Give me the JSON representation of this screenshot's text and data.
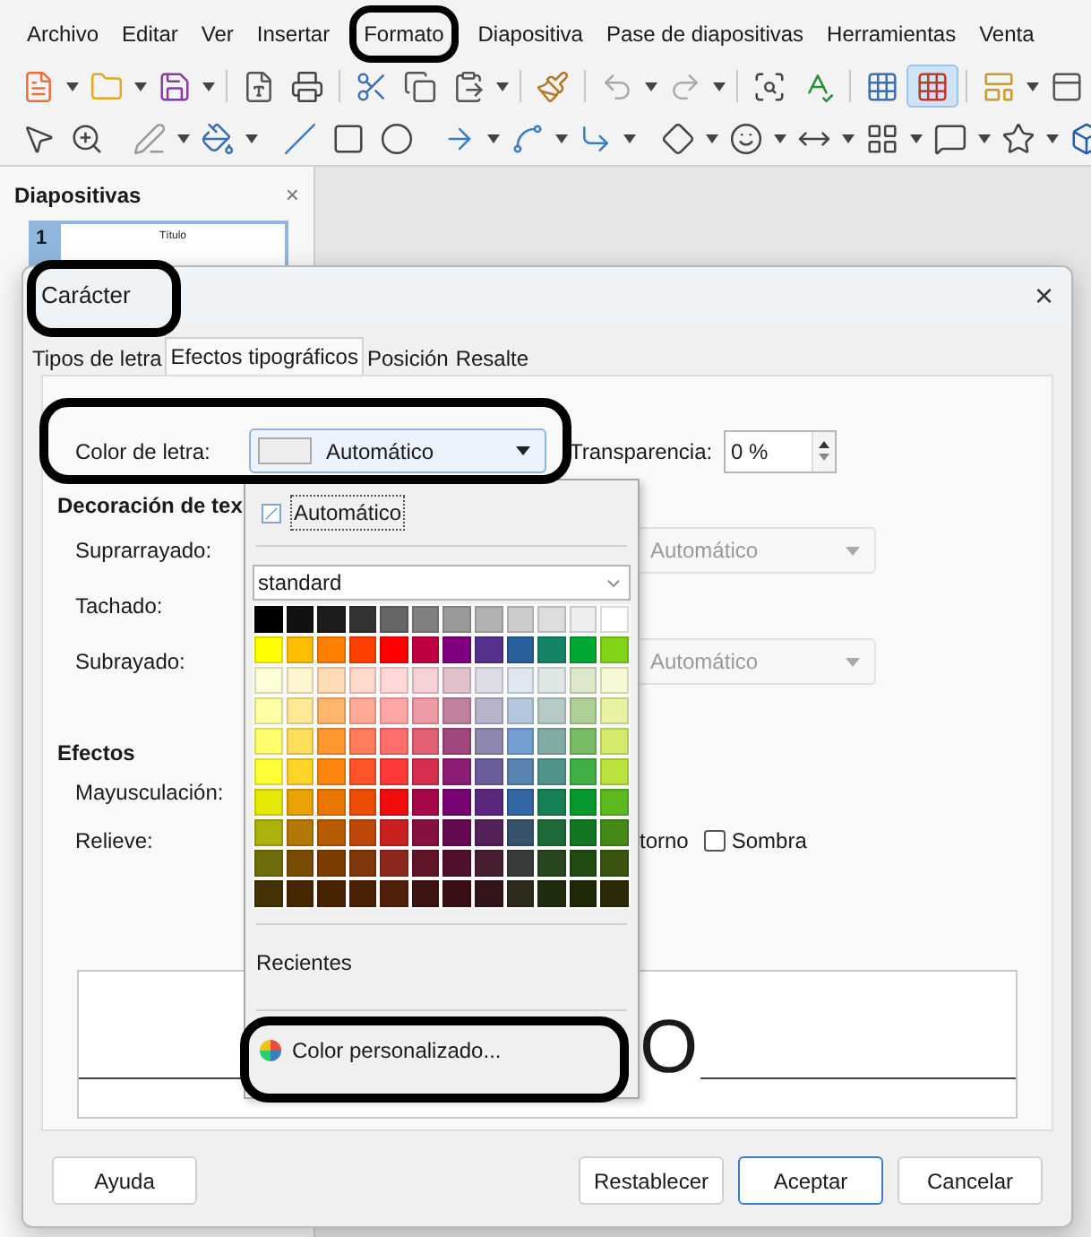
{
  "menu_bar": [
    {
      "label": "Archivo",
      "annotated": false
    },
    {
      "label": "Editar",
      "annotated": false
    },
    {
      "label": "Ver",
      "annotated": false
    },
    {
      "label": "Insertar",
      "annotated": false
    },
    {
      "label": "Formato",
      "annotated": true
    },
    {
      "label": "Diapositiva",
      "annotated": false
    },
    {
      "label": "Pase de diapositivas",
      "annotated": false
    },
    {
      "label": "Herramientas",
      "annotated": false
    },
    {
      "label": "Venta",
      "annotated": false
    }
  ],
  "toolbar": {
    "snap_grid_selected": true
  },
  "sidebar": {
    "title": "Diapositivas",
    "close": "×",
    "slides": [
      {
        "number": "1",
        "title": "Título",
        "selected": true
      }
    ]
  },
  "dialog": {
    "title": "Carácter",
    "close": "×",
    "tabs": [
      {
        "label": "Tipos de letra",
        "selected": false
      },
      {
        "label": "Efectos tipográficos",
        "selected": true
      },
      {
        "label": "Posición",
        "selected": false
      },
      {
        "label": "Resalte",
        "selected": false
      }
    ],
    "font_color": {
      "label": "Color de letra:",
      "value": "Automático",
      "transparency_label": "Transparencia:",
      "transparency_value": "0 %"
    },
    "decoration": {
      "heading": "Decoración de tex",
      "rows": [
        {
          "label": "Suprarrayado:",
          "value": "Automático",
          "disabled": true
        },
        {
          "label": "Tachado:"
        },
        {
          "label": "Subrayado:",
          "value": "Automático",
          "disabled": true
        }
      ]
    },
    "effects": {
      "heading": "Efectos",
      "rows": [
        {
          "label": "Mayusculación:"
        },
        {
          "label": "Relieve:"
        }
      ],
      "outline_label": "torno",
      "shadow": {
        "label": "Sombra",
        "checked": false
      }
    },
    "preview": {
      "text": "O"
    },
    "buttons": [
      {
        "label": "Ayuda",
        "kind": "help",
        "default": false
      },
      {
        "label": "Restablecer",
        "kind": "action",
        "default": false
      },
      {
        "label": "Aceptar",
        "kind": "action",
        "default": true
      },
      {
        "label": "Cancelar",
        "kind": "action",
        "default": false
      }
    ]
  },
  "color_popup": {
    "automatic": "Automático",
    "palette_name": "standard",
    "recent_label": "Recientes",
    "custom_label": "Color personalizado...",
    "palette_rows": [
      {
        "swatches": [
          {
            "color": "#000000"
          },
          {
            "color": "#111111"
          },
          {
            "color": "#1c1c1c"
          },
          {
            "color": "#333333"
          },
          {
            "color": "#666666"
          },
          {
            "color": "#808080"
          },
          {
            "color": "#999999"
          },
          {
            "color": "#b2b2b2"
          },
          {
            "color": "#cccccc"
          },
          {
            "color": "#dddddd"
          },
          {
            "color": "#eeeeee"
          },
          {
            "color": "#ffffff"
          }
        ]
      },
      {
        "swatches": [
          {
            "color": "#ffff00"
          },
          {
            "color": "#ffbf00"
          },
          {
            "color": "#ff8000"
          },
          {
            "color": "#ff4000"
          },
          {
            "color": "#ff0000"
          },
          {
            "color": "#bf0041"
          },
          {
            "color": "#800080"
          },
          {
            "color": "#55308d"
          },
          {
            "color": "#2a6099"
          },
          {
            "color": "#158466"
          },
          {
            "color": "#00a933"
          },
          {
            "color": "#81d41a"
          }
        ]
      },
      {
        "swatches": [
          {
            "color": "#ffffd7"
          },
          {
            "color": "#fff5ce"
          },
          {
            "color": "#ffdbb6"
          },
          {
            "color": "#ffd8ce"
          },
          {
            "color": "#ffd7d7"
          },
          {
            "color": "#f7d1d5"
          },
          {
            "color": "#e0c2cd"
          },
          {
            "color": "#dedce6"
          },
          {
            "color": "#dee6ef"
          },
          {
            "color": "#dee7e5"
          },
          {
            "color": "#dde8cb"
          },
          {
            "color": "#f6f9d4"
          }
        ]
      },
      {
        "swatches": [
          {
            "color": "#ffffa6"
          },
          {
            "color": "#ffe994"
          },
          {
            "color": "#ffb66c"
          },
          {
            "color": "#ffaa95"
          },
          {
            "color": "#ffa6a6"
          },
          {
            "color": "#ec9ba4"
          },
          {
            "color": "#bf819e"
          },
          {
            "color": "#b7b3ca"
          },
          {
            "color": "#b4c7dc"
          },
          {
            "color": "#b3cac7"
          },
          {
            "color": "#afd095"
          },
          {
            "color": "#e8f2a1"
          }
        ]
      },
      {
        "swatches": [
          {
            "color": "#ffff6d"
          },
          {
            "color": "#ffde59"
          },
          {
            "color": "#ff972f"
          },
          {
            "color": "#ff7b59"
          },
          {
            "color": "#ff6d6d"
          },
          {
            "color": "#e16173"
          },
          {
            "color": "#a1467e"
          },
          {
            "color": "#8e86ae"
          },
          {
            "color": "#729fcf"
          },
          {
            "color": "#81aca6"
          },
          {
            "color": "#77bc65"
          },
          {
            "color": "#d4ea6b"
          }
        ]
      },
      {
        "swatches": [
          {
            "color": "#ffff38"
          },
          {
            "color": "#ffd428"
          },
          {
            "color": "#ff860d"
          },
          {
            "color": "#ff5429"
          },
          {
            "color": "#ff3838"
          },
          {
            "color": "#d62e4e"
          },
          {
            "color": "#8d1d75"
          },
          {
            "color": "#6b5e9b"
          },
          {
            "color": "#5983b0"
          },
          {
            "color": "#50938a"
          },
          {
            "color": "#3faf46"
          },
          {
            "color": "#bbe33d"
          }
        ]
      },
      {
        "swatches": [
          {
            "color": "#e6e905"
          },
          {
            "color": "#e8a202"
          },
          {
            "color": "#ea7500"
          },
          {
            "color": "#ed4c05"
          },
          {
            "color": "#f10d0c"
          },
          {
            "color": "#a7074b"
          },
          {
            "color": "#780373"
          },
          {
            "color": "#5b277d"
          },
          {
            "color": "#3465a4"
          },
          {
            "color": "#168253"
          },
          {
            "color": "#069a2e"
          },
          {
            "color": "#5eb91e"
          }
        ]
      },
      {
        "swatches": [
          {
            "color": "#acb20c"
          },
          {
            "color": "#b47804"
          },
          {
            "color": "#b85c00"
          },
          {
            "color": "#be480a"
          },
          {
            "color": "#c9211e"
          },
          {
            "color": "#861141"
          },
          {
            "color": "#650953"
          },
          {
            "color": "#55215b"
          },
          {
            "color": "#355269"
          },
          {
            "color": "#1e6a39"
          },
          {
            "color": "#127622"
          },
          {
            "color": "#468a1a"
          }
        ]
      },
      {
        "swatches": [
          {
            "color": "#706e0c"
          },
          {
            "color": "#784b04"
          },
          {
            "color": "#7b3d00"
          },
          {
            "color": "#813709"
          },
          {
            "color": "#8d281e"
          },
          {
            "color": "#611729"
          },
          {
            "color": "#4e102d"
          },
          {
            "color": "#481d32"
          },
          {
            "color": "#383d3c"
          },
          {
            "color": "#28471f"
          },
          {
            "color": "#224b12"
          },
          {
            "color": "#395511"
          }
        ]
      },
      {
        "swatches": [
          {
            "color": "#443205"
          },
          {
            "color": "#472702"
          },
          {
            "color": "#492300"
          },
          {
            "color": "#4b2204"
          },
          {
            "color": "#50200b"
          },
          {
            "color": "#3e1412"
          },
          {
            "color": "#3a0f14"
          },
          {
            "color": "#33141a"
          },
          {
            "color": "#2e2a1c"
          },
          {
            "color": "#1f2c0e"
          },
          {
            "color": "#1e2a07"
          },
          {
            "color": "#2c2a06"
          }
        ]
      }
    ]
  }
}
